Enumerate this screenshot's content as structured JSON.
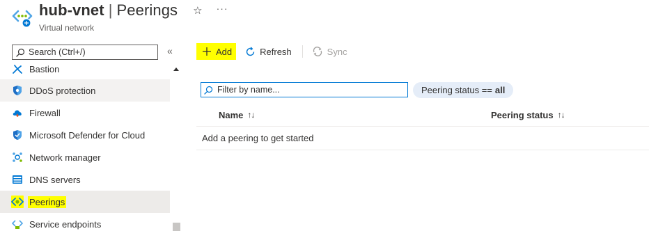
{
  "header": {
    "resource_name": "hub-vnet",
    "separator": "|",
    "page_name": "Peerings",
    "subtitle": "Virtual network",
    "favorite_glyph": "☆",
    "more_glyph": "···",
    "icon": "virtual-network-icon"
  },
  "sidebar": {
    "search_placeholder": "Search (Ctrl+/)",
    "collapse_glyph": "«",
    "items": [
      {
        "label": "Bastion",
        "icon": "bastion-icon"
      },
      {
        "label": "DDoS protection",
        "icon": "ddos-shield-icon"
      },
      {
        "label": "Firewall",
        "icon": "firewall-icon"
      },
      {
        "label": "Microsoft Defender for Cloud",
        "icon": "defender-shield-icon"
      },
      {
        "label": "Network manager",
        "icon": "network-manager-icon"
      },
      {
        "label": "DNS servers",
        "icon": "dns-servers-icon"
      },
      {
        "label": "Peerings",
        "icon": "peerings-icon",
        "selected": true
      },
      {
        "label": "Service endpoints",
        "icon": "service-endpoints-icon"
      }
    ]
  },
  "toolbar": {
    "add_label": "Add",
    "refresh_label": "Refresh",
    "sync_label": "Sync"
  },
  "filter": {
    "placeholder": "Filter by name...",
    "pill_prefix": "Peering status ==",
    "pill_value": "all"
  },
  "grid": {
    "columns": [
      "Name",
      "Peering status"
    ],
    "sort_glyph": "↑↓",
    "empty_message": "Add a peering to get started"
  },
  "colors": {
    "highlight": "#ffff00",
    "accent": "#0078d4",
    "pill_bg": "#e5edf8",
    "selected_bg": "#edebe9"
  }
}
